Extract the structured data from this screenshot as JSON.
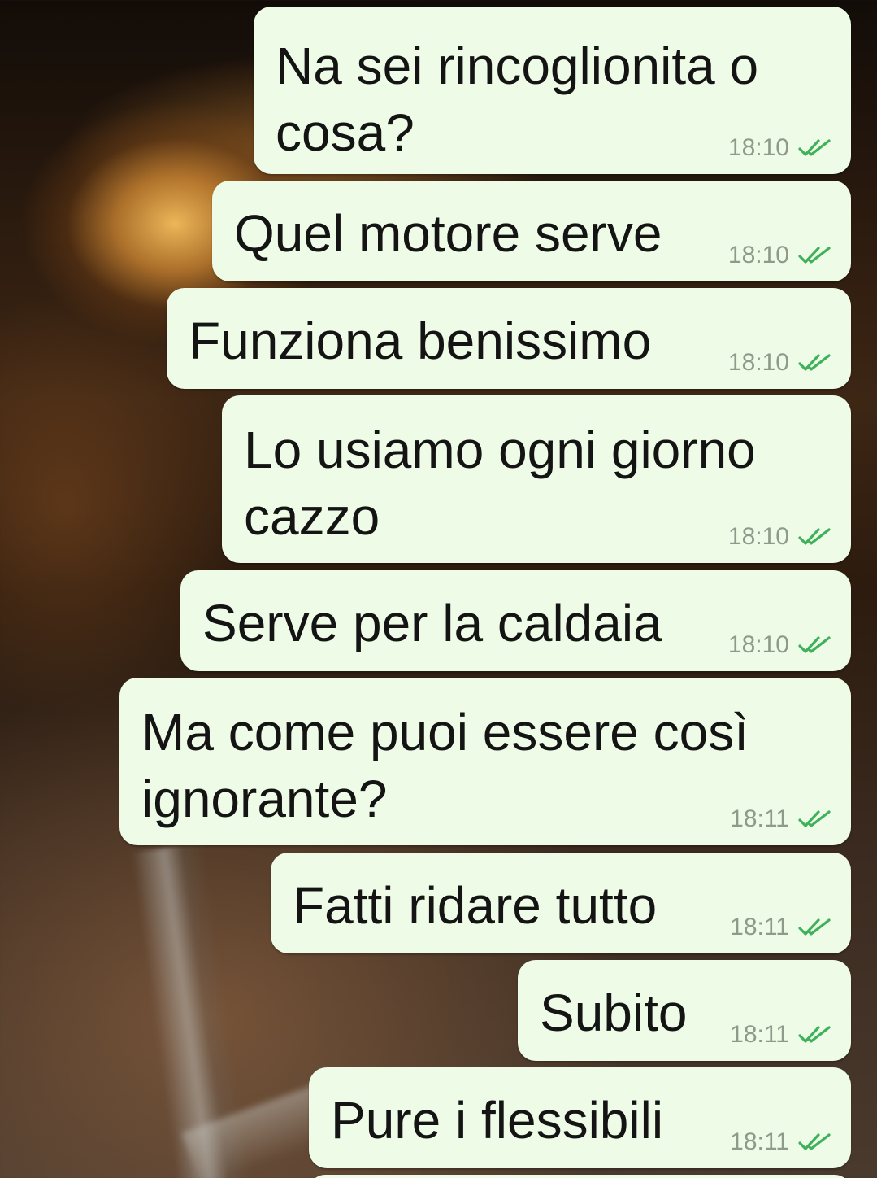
{
  "theme": {
    "bubble_color": "#eefbe6",
    "text_color": "#141414",
    "time_color": "#8f9a8a",
    "read_tick_color": "#3fb15b"
  },
  "messages": [
    {
      "text": "Na sei rincoglionita o\ncosa?",
      "time": "18:10",
      "status": "read",
      "status_icon": "double-check-icon"
    },
    {
      "text": "Quel motore serve",
      "time": "18:10",
      "status": "read",
      "status_icon": "double-check-icon"
    },
    {
      "text": "Funziona benissimo",
      "time": "18:10",
      "status": "read",
      "status_icon": "double-check-icon"
    },
    {
      "text": "Lo usiamo ogni giorno\ncazzo",
      "time": "18:10",
      "status": "read",
      "status_icon": "double-check-icon"
    },
    {
      "text": "Serve per la caldaia",
      "time": "18:10",
      "status": "read",
      "status_icon": "double-check-icon"
    },
    {
      "text": "Ma come puoi essere così\nignorante?",
      "time": "18:11",
      "status": "read",
      "status_icon": "double-check-icon"
    },
    {
      "text": "Fatti ridare tutto",
      "time": "18:11",
      "status": "read",
      "status_icon": "double-check-icon"
    },
    {
      "text": "Subito",
      "time": "18:11",
      "status": "read",
      "status_icon": "double-check-icon"
    },
    {
      "text": "Pure i flessibili",
      "time": "18:11",
      "status": "read",
      "status_icon": "double-check-icon"
    }
  ]
}
